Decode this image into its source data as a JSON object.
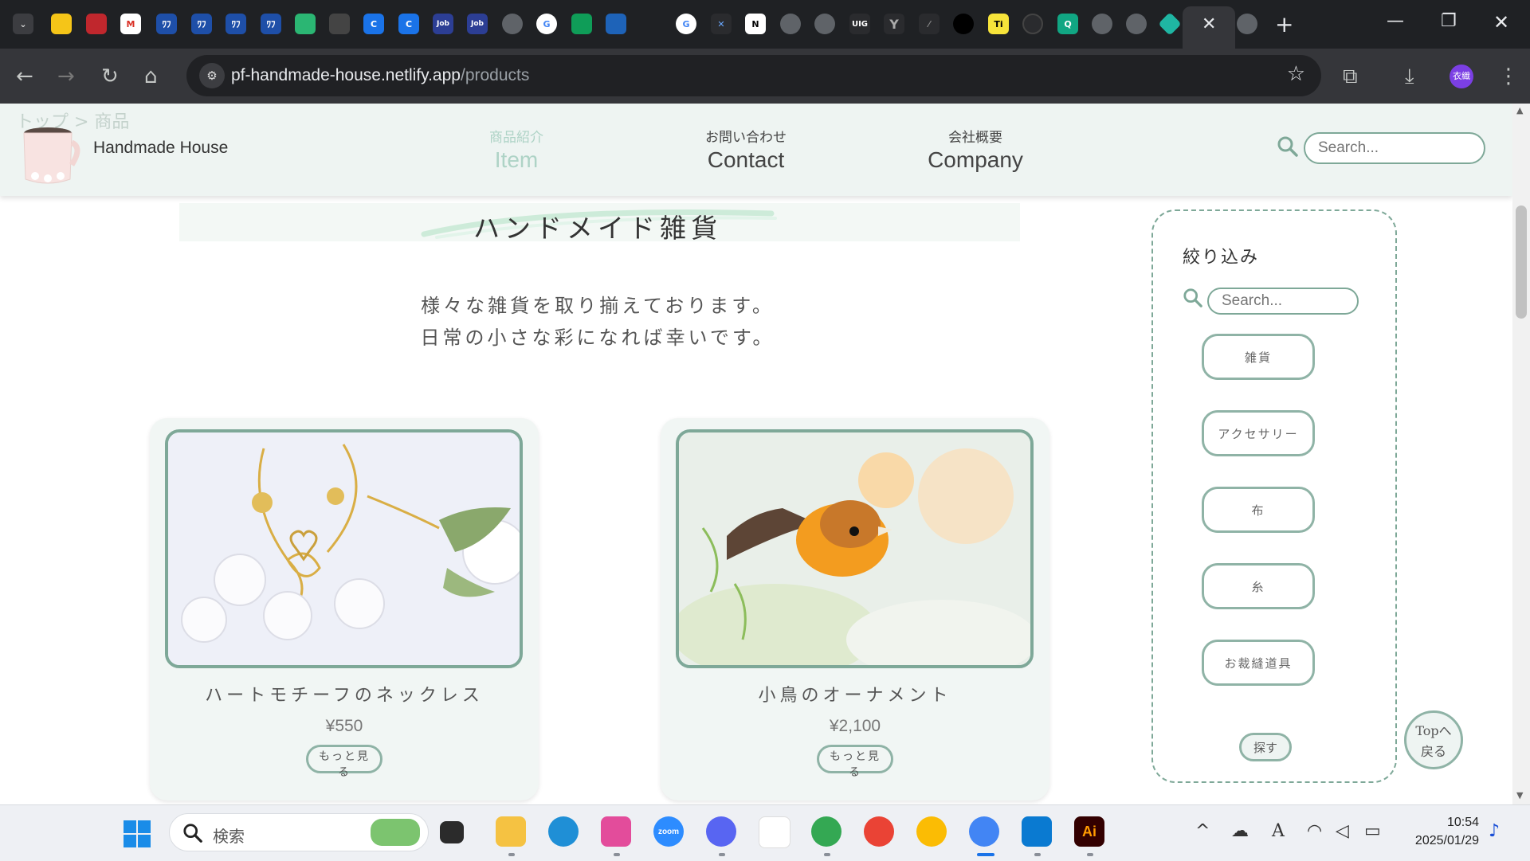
{
  "browser": {
    "url_host": "pf-handmade-house.netlify.app",
    "url_path": "/products",
    "profile_label": "衣織",
    "tab_icons": [
      "gift-icon",
      "stack-icon",
      "gmail-icon",
      "jp-app-icon",
      "jp-app-icon",
      "jp-app-icon",
      "jp-app-icon",
      "chat-icon",
      "robot-icon",
      "c-icon",
      "c-icon",
      "job-pass-icon",
      "job-pass-icon",
      "globe-icon",
      "google-icon",
      "drive-icon",
      "library-icon",
      "google-icon",
      "x-icon",
      "notion-icon",
      "globe-icon",
      "globe-icon",
      "uig-icon",
      "y-icon",
      "sketch-icon",
      "robot-icon",
      "ti-icon",
      "github-icon",
      "q-icon",
      "globe-icon",
      "globe-icon",
      "diamond-icon"
    ],
    "tab_labels": {
      "jp_app": "ﾜﾌ",
      "job": "Job",
      "uig": "UIG",
      "ti": "Ti",
      "q": "Q"
    }
  },
  "site": {
    "breadcrumb": "トップ > 商品",
    "brand": "Handmade House",
    "nav": [
      {
        "jp": "商品紹介",
        "en": "Item",
        "active": true
      },
      {
        "jp": "お問い合わせ",
        "en": "Contact",
        "active": false
      },
      {
        "jp": "会社概要",
        "en": "Company",
        "active": false
      }
    ],
    "search_placeholder": "Search..."
  },
  "main": {
    "title": "ハンドメイド雑貨",
    "intro_line1": "様々な雑貨を取り揃えております。",
    "intro_line2": "日常の小さな彩になれば幸いです。",
    "products": [
      {
        "name": "ハートモチーフのネックレス",
        "price": "¥550",
        "more": "もっと見る"
      },
      {
        "name": "小鳥のオーナメント",
        "price": "¥2,100",
        "more": "もっと見る"
      }
    ]
  },
  "filter": {
    "title": "絞り込み",
    "search_placeholder": "Search...",
    "categories": [
      "雑貨",
      "アクセサリー",
      "布",
      "糸",
      "お裁縫道具"
    ],
    "submit": "探す"
  },
  "to_top": {
    "line1": "Topへ",
    "line2": "戻る"
  },
  "taskbar": {
    "search_label": "検索",
    "time": "10:54",
    "date": "2025/01/29",
    "apps": {
      "zoom": "zoom",
      "illustrator": "Ai"
    }
  },
  "colors": {
    "accent": "#7ea898",
    "header_bg": "#eef4f2",
    "card_bg": "#f1f6f4",
    "active_nav": "#aed3c6"
  }
}
